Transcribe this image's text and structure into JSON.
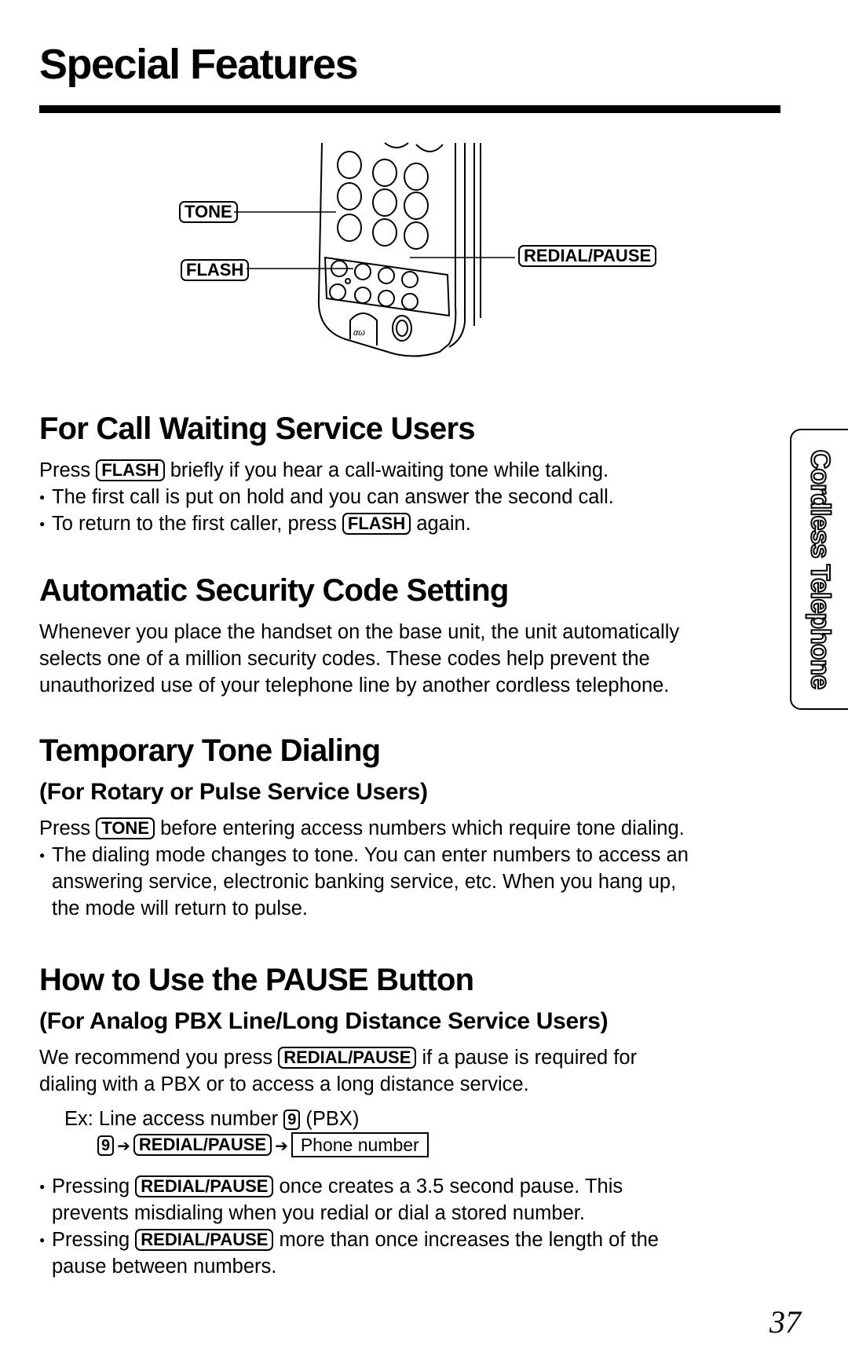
{
  "page": {
    "title": "Special Features",
    "page_number": "37",
    "side_tab": "Cordless Telephone"
  },
  "illustration": {
    "callouts": {
      "tone": "TONE",
      "flash": "FLASH",
      "redial_pause": "REDIAL/PAUSE"
    },
    "handset_button_glyph": "αω"
  },
  "sections": {
    "call_waiting": {
      "heading": "For Call Waiting Service Users",
      "line1_before": "Press ",
      "line1_key": "FLASH",
      "line1_after": " briefly if you hear a call-waiting tone while talking.",
      "bullet1": "The first call is put on hold and you can answer the second call.",
      "bullet2_before": "To return to the first caller, press ",
      "bullet2_key": "FLASH",
      "bullet2_after": " again."
    },
    "security": {
      "heading": "Automatic Security Code Setting",
      "lines": [
        "Whenever you place the handset on the base unit, the unit automatically",
        "selects one of a million security codes. These codes help prevent the",
        "unauthorized use of your telephone line by another cordless telephone."
      ]
    },
    "tone_dialing": {
      "heading": "Temporary Tone Dialing",
      "subheading": "(For Rotary or Pulse Service Users)",
      "line1_before": "Press ",
      "line1_key": "TONE",
      "line1_after": " before entering access numbers which require tone dialing.",
      "bullet1_lines": [
        "The dialing mode changes to tone. You can enter numbers to access an",
        "answering service, electronic banking service, etc. When you hang up,",
        "the mode will return to pulse."
      ]
    },
    "pause": {
      "heading": "How to Use the PAUSE Button",
      "subheading": "(For Analog PBX Line/Long Distance Service Users)",
      "line1_before": "We recommend you press ",
      "line1_key": "REDIAL/PAUSE",
      "line1_after": " if a pause is required for",
      "line2": "dialing with a PBX or to access a long distance service.",
      "example": {
        "prefix": "Ex: Line access number ",
        "key": "9",
        "suffix": " (PBX)",
        "seq_key1": "9",
        "seq_arrow": "➔",
        "seq_key2": "REDIAL/PAUSE",
        "seq_box": "Phone number"
      },
      "bullet1_before": "Pressing ",
      "bullet1_key": "REDIAL/PAUSE",
      "bullet1_after": " once creates a 3.5 second pause. This",
      "bullet1_line2": "prevents misdialing when you redial or dial a stored number.",
      "bullet2_before": "Pressing ",
      "bullet2_key": "REDIAL/PAUSE",
      "bullet2_after": " more than once increases the length of the",
      "bullet2_line2": "pause between numbers."
    }
  }
}
